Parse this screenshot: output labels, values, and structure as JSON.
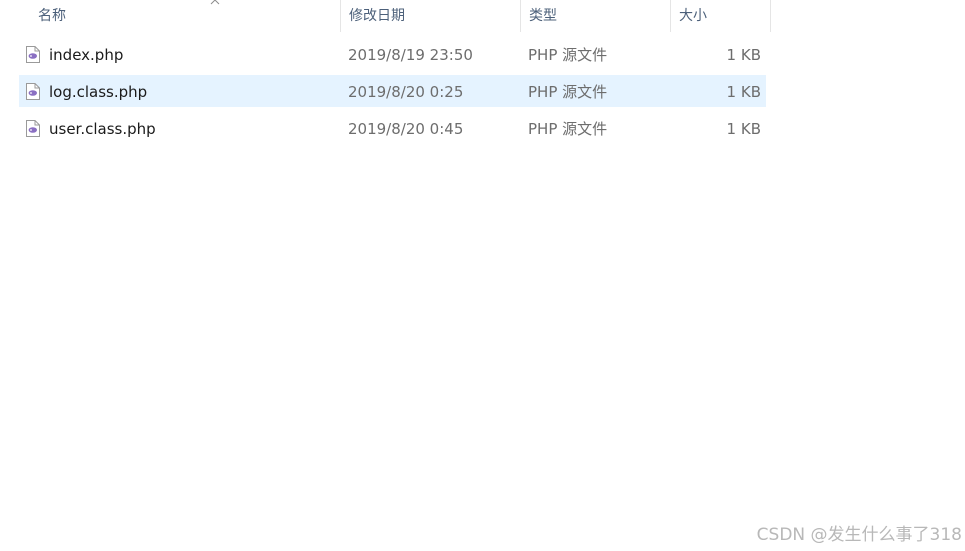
{
  "columns": {
    "name": "名称",
    "date": "修改日期",
    "type": "类型",
    "size": "大小"
  },
  "sort": {
    "column": "name",
    "direction": "ascending",
    "icon": "chevron-up-icon"
  },
  "files": [
    {
      "name": "index.php",
      "date": "2019/8/19 23:50",
      "type": "PHP 源文件",
      "size": "1 KB",
      "icon": "php-file-icon",
      "selected": false
    },
    {
      "name": "log.class.php",
      "date": "2019/8/20 0:25",
      "type": "PHP 源文件",
      "size": "1 KB",
      "icon": "php-file-icon",
      "selected": true
    },
    {
      "name": "user.class.php",
      "date": "2019/8/20 0:45",
      "type": "PHP 源文件",
      "size": "1 KB",
      "icon": "php-file-icon",
      "selected": false
    }
  ],
  "watermark": "CSDN @发生什么事了318",
  "colors": {
    "selection": "#e5f3ff",
    "header_text": "#4c607a",
    "meta_text": "#6d6d6d",
    "icon_accent": "#8a6fc2"
  }
}
